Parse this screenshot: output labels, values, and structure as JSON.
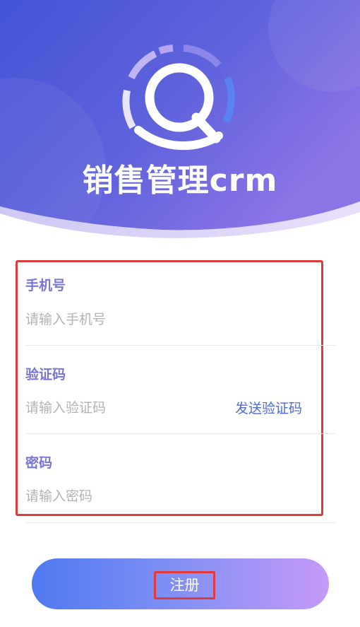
{
  "app": {
    "title": "销售管理crm"
  },
  "colors": {
    "header_start": "#4557d8",
    "header_end": "#8a72e6",
    "accent_label": "#7776d8",
    "link": "#4f6bd8",
    "button_start": "#4f78f0",
    "button_end": "#c59af7",
    "highlight_border": "#e03a3a"
  },
  "form": {
    "phone": {
      "label": "手机号",
      "placeholder": "请输入手机号",
      "value": ""
    },
    "code": {
      "label": "验证码",
      "placeholder": "请输入验证码",
      "value": "",
      "send_label": "发送验证码"
    },
    "password": {
      "label": "密码",
      "placeholder": "请输入密码",
      "value": ""
    }
  },
  "actions": {
    "register_label": "注册"
  },
  "icons": {
    "logo": "search-logo-icon"
  }
}
